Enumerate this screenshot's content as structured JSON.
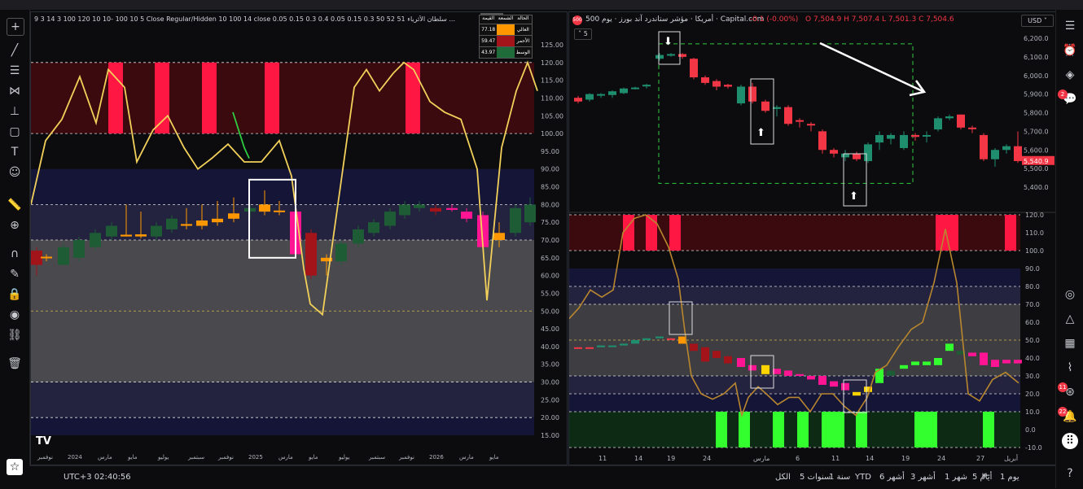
{
  "left_chart": {
    "header_text": "9 3 14 3 100 120 10 10- 100 10 5 Close Regular/Hidden 10 100 14 close 0.05 0.15 0.3 0.4 0.05 0.15 0.3 50 52 51 سلطان الأثرياء ...",
    "last_value": "48.60",
    "legend_header": [
      "القيمة",
      "الشمعة",
      "الحالة"
    ],
    "legend_rows": [
      {
        "label": "العالي",
        "value": "77.18",
        "color": "#ff9800"
      },
      {
        "label": "الأحمر",
        "value": "59.47",
        "color": "#a3141a"
      },
      {
        "label": "الوسط",
        "value": "43.97",
        "color": "#1f6b3a"
      }
    ],
    "y_ticks": [
      "125.00",
      "120.00",
      "115.00",
      "110.00",
      "105.00",
      "100.00",
      "95.00",
      "90.00",
      "85.00",
      "80.00",
      "75.00",
      "70.00",
      "65.00",
      "60.00",
      "55.00",
      "50.00",
      "45.00",
      "40.00",
      "35.00",
      "30.00",
      "25.00",
      "20.00",
      "15.00"
    ],
    "x_ticks": [
      "نوفمبر",
      "2024",
      "مارس",
      "مايو",
      "يوليو",
      "سبتمبر",
      "نوفمبر",
      "2025",
      "مارس",
      "مايو",
      "يوليو",
      "سبتمبر",
      "نوفمبر",
      "2026",
      "مارس",
      "مايو"
    ],
    "logo": "TV"
  },
  "right_chart": {
    "symbol_badge": "500",
    "title": "500 أمريكا · مؤشر ستاندرد آند بورز · يوم · Capital.com",
    "change": "-0.1 (-0.00%)",
    "ohlc": "O 7,504.9  H 7,507.4  L 7,501.3  C 7,504.6",
    "indicator_count": "5",
    "currency": "USD",
    "price_ticks": [
      "6,200.0",
      "6,100.0",
      "6,000.0",
      "5,900.0",
      "5,800.0",
      "5,700.0",
      "5,600.0",
      "5,540.9",
      "5,500.0",
      "5,400.0"
    ],
    "last_price": "5,540.9",
    "osc_ticks": [
      "120.0",
      "110.0",
      "100.0",
      "90.0",
      "80.0",
      "70.0",
      "60.0",
      "50.0",
      "40.0",
      "30.0",
      "20.0",
      "10.0",
      "0.0",
      "-10.0"
    ],
    "x_ticks": [
      "11",
      "14",
      "19",
      "24",
      "مارس",
      "6",
      "11",
      "14",
      "19",
      "24",
      "27",
      "أبريل"
    ]
  },
  "bottom_bar": {
    "timeframes": [
      "يوم 1",
      "أيام 5",
      "شهر 1",
      "أشهر 3",
      "أشهر 6",
      "YTD",
      "سنة 1",
      "سنوات 5",
      "الكل"
    ],
    "time": "UTC+3 02:40:56"
  },
  "right_toolbar": {
    "badges": [
      "2",
      "11",
      "22"
    ]
  },
  "colors": {
    "overbought": "#ff1744",
    "bull_green": "#1e5c36",
    "line_yellow": "#f2d05a",
    "bright_green": "#33ff2e"
  }
}
